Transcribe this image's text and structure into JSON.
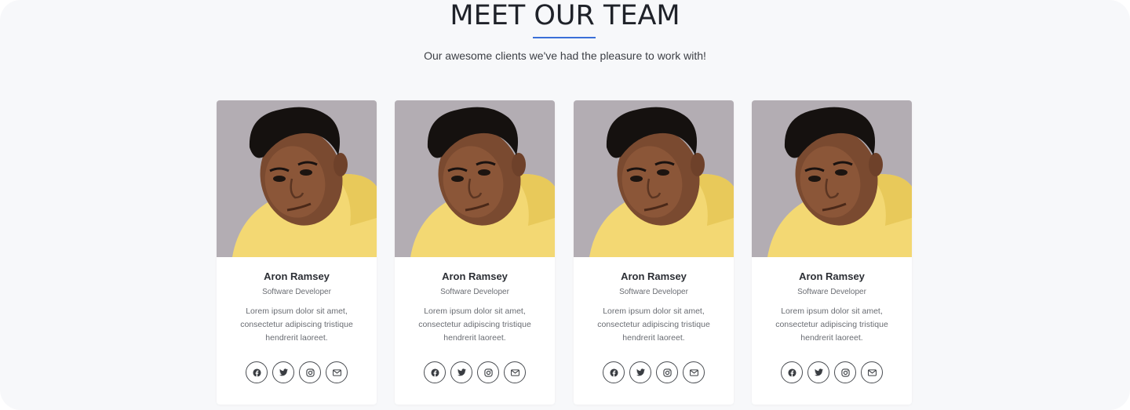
{
  "section": {
    "title": "MEET OUR TEAM",
    "subtitle": "Our awesome clients we've had the pleasure to work with!",
    "accent_color": "#3b6fd8"
  },
  "team": [
    {
      "name": "Aron Ramsey",
      "role": "Software Developer",
      "bio": "Lorem ipsum dolor sit amet, consectetur adipiscing tristique hendrerit laoreet.",
      "socials": [
        "facebook-icon",
        "twitter-icon",
        "instagram-icon",
        "mail-icon"
      ]
    },
    {
      "name": "Aron Ramsey",
      "role": "Software Developer",
      "bio": "Lorem ipsum dolor sit amet, consectetur adipiscing tristique hendrerit laoreet.",
      "socials": [
        "facebook-icon",
        "twitter-icon",
        "instagram-icon",
        "mail-icon"
      ]
    },
    {
      "name": "Aron Ramsey",
      "role": "Software Developer",
      "bio": "Lorem ipsum dolor sit amet, consectetur adipiscing tristique hendrerit laoreet.",
      "socials": [
        "facebook-icon",
        "twitter-icon",
        "instagram-icon",
        "mail-icon"
      ]
    },
    {
      "name": "Aron Ramsey",
      "role": "Software Developer",
      "bio": "Lorem ipsum dolor sit amet, consectetur adipiscing tristique hendrerit laoreet.",
      "socials": [
        "facebook-icon",
        "twitter-icon",
        "instagram-icon",
        "mail-icon"
      ]
    }
  ]
}
